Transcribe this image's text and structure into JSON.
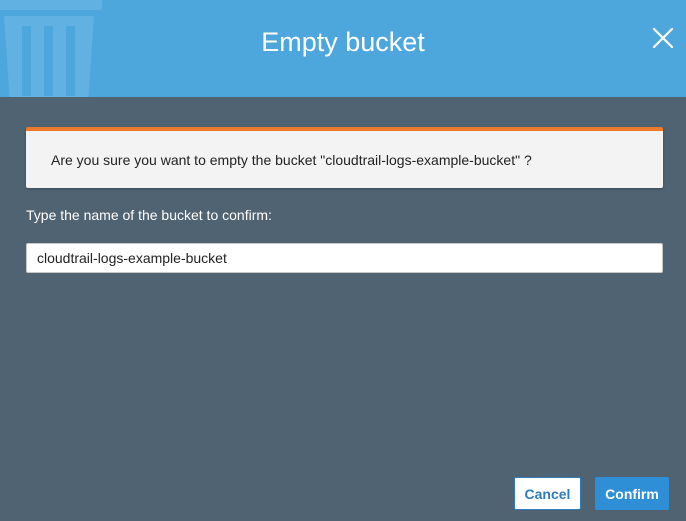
{
  "dialog": {
    "title": "Empty bucket",
    "header_icon": "trash-icon",
    "close_icon": "close-icon",
    "colors": {
      "header": "#4ea7dc",
      "body": "#4f6373",
      "alert_border": "#ec7a2a",
      "primary": "#2f8fd6"
    }
  },
  "alert": {
    "message": "Are you sure you want to empty the bucket \"cloudtrail-logs-example-bucket\" ?"
  },
  "confirm": {
    "label": "Type the name of the bucket to confirm:",
    "input_value": "cloudtrail-logs-example-bucket"
  },
  "buttons": {
    "cancel_label": "Cancel",
    "confirm_label": "Confirm"
  }
}
